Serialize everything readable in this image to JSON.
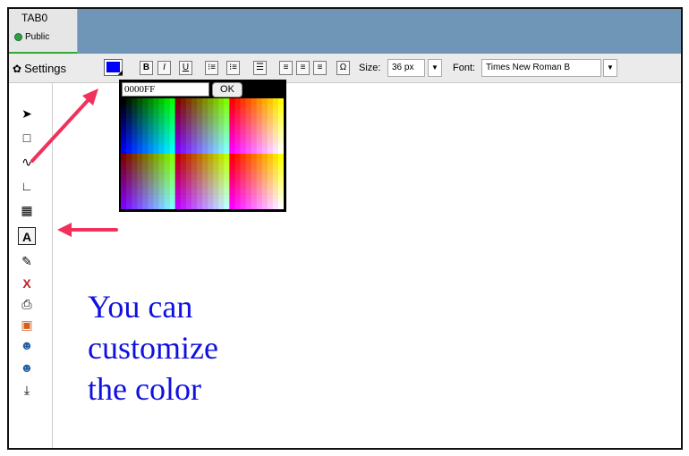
{
  "tab": {
    "title": "TAB0",
    "subtitle": "Public"
  },
  "toolbar": {
    "settings_label": "Settings",
    "current_color": "#0000FF",
    "format_buttons": [
      "B",
      "I",
      "U",
      "⁝≡",
      "⁝≡",
      "☰",
      "≡",
      "≡",
      "≡",
      "Ω"
    ],
    "size_label": "Size:",
    "size_value": "36 px",
    "font_label": "Font:",
    "font_value": "Times New Roman B"
  },
  "color_picker": {
    "hex_value": "0000FF",
    "ok_label": "OK"
  },
  "tools": [
    {
      "name": "pointer-icon",
      "glyph": "➤"
    },
    {
      "name": "rectangle-icon",
      "glyph": "□"
    },
    {
      "name": "freehand-icon",
      "glyph": "∿"
    },
    {
      "name": "axes-icon",
      "glyph": "∟"
    },
    {
      "name": "grid-icon",
      "glyph": "▦"
    },
    {
      "name": "text-tool-icon",
      "glyph": "A"
    },
    {
      "name": "eraser-icon",
      "glyph": "✎"
    },
    {
      "name": "delete-icon",
      "glyph": "X"
    },
    {
      "name": "print-icon",
      "glyph": "⎙"
    },
    {
      "name": "presentation-icon",
      "glyph": "▣"
    },
    {
      "name": "user-icon",
      "glyph": "☻"
    },
    {
      "name": "remove-user-icon",
      "glyph": "☻"
    },
    {
      "name": "import-icon",
      "glyph": "⤓"
    }
  ],
  "canvas_text": "You can\ncustomize\nthe color",
  "colors": {
    "text": "#1010e0",
    "arrow": "#f0325a",
    "tabbar": "#6f96b7",
    "active": "#2ea043"
  }
}
